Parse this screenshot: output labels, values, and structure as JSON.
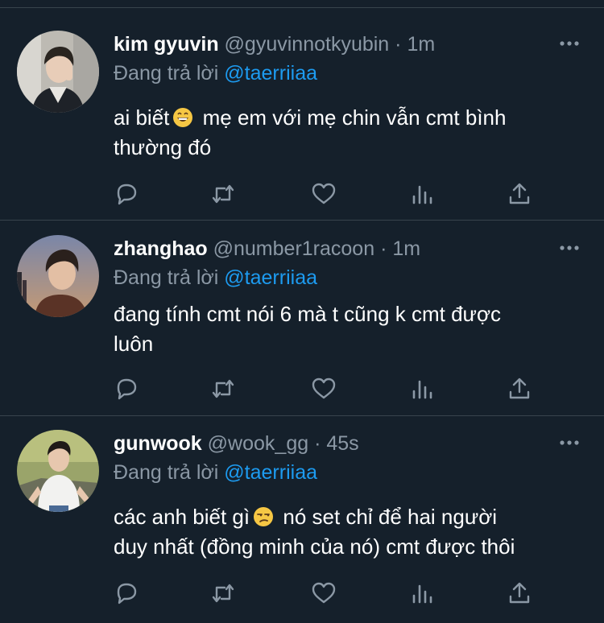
{
  "replying_prefix": "Đang trả lời",
  "tweets": [
    {
      "name": "kim gyuvin",
      "handle": "@gyuvinnotkyubin",
      "dot": "·",
      "time": "1m",
      "mention": "@taerriiaa",
      "text_before": "ai biết",
      "emoji": "grinning-face-emoji",
      "text_line1_after": "mẹ em với mẹ chin vẫn cmt bình",
      "text_line2": "thường đó"
    },
    {
      "name": "zhanghao",
      "handle": "@number1racoon",
      "dot": "·",
      "time": "1m",
      "mention": "@taerriiaa",
      "text_line1": "đang tính cmt nói 6 mà t cũng k cmt được",
      "text_line2": "luôn"
    },
    {
      "name": "gunwook",
      "handle": "@wook_gg",
      "dot": "·",
      "time": "45s",
      "mention": "@taerriiaa",
      "text_before": "các anh biết gì",
      "emoji": "unamused-face-emoji",
      "text_line1_after": "nó set chỉ để hai người",
      "text_line2": "duy nhất (đồng minh của nó) cmt được thôi"
    }
  ],
  "colors": {
    "background": "#15202b",
    "secondary_text": "#8b98a5",
    "link": "#1d9bf0",
    "divider": "#38444d"
  },
  "icons": [
    "reply-icon",
    "retweet-icon",
    "like-icon",
    "views-icon",
    "share-icon",
    "more-icon"
  ]
}
